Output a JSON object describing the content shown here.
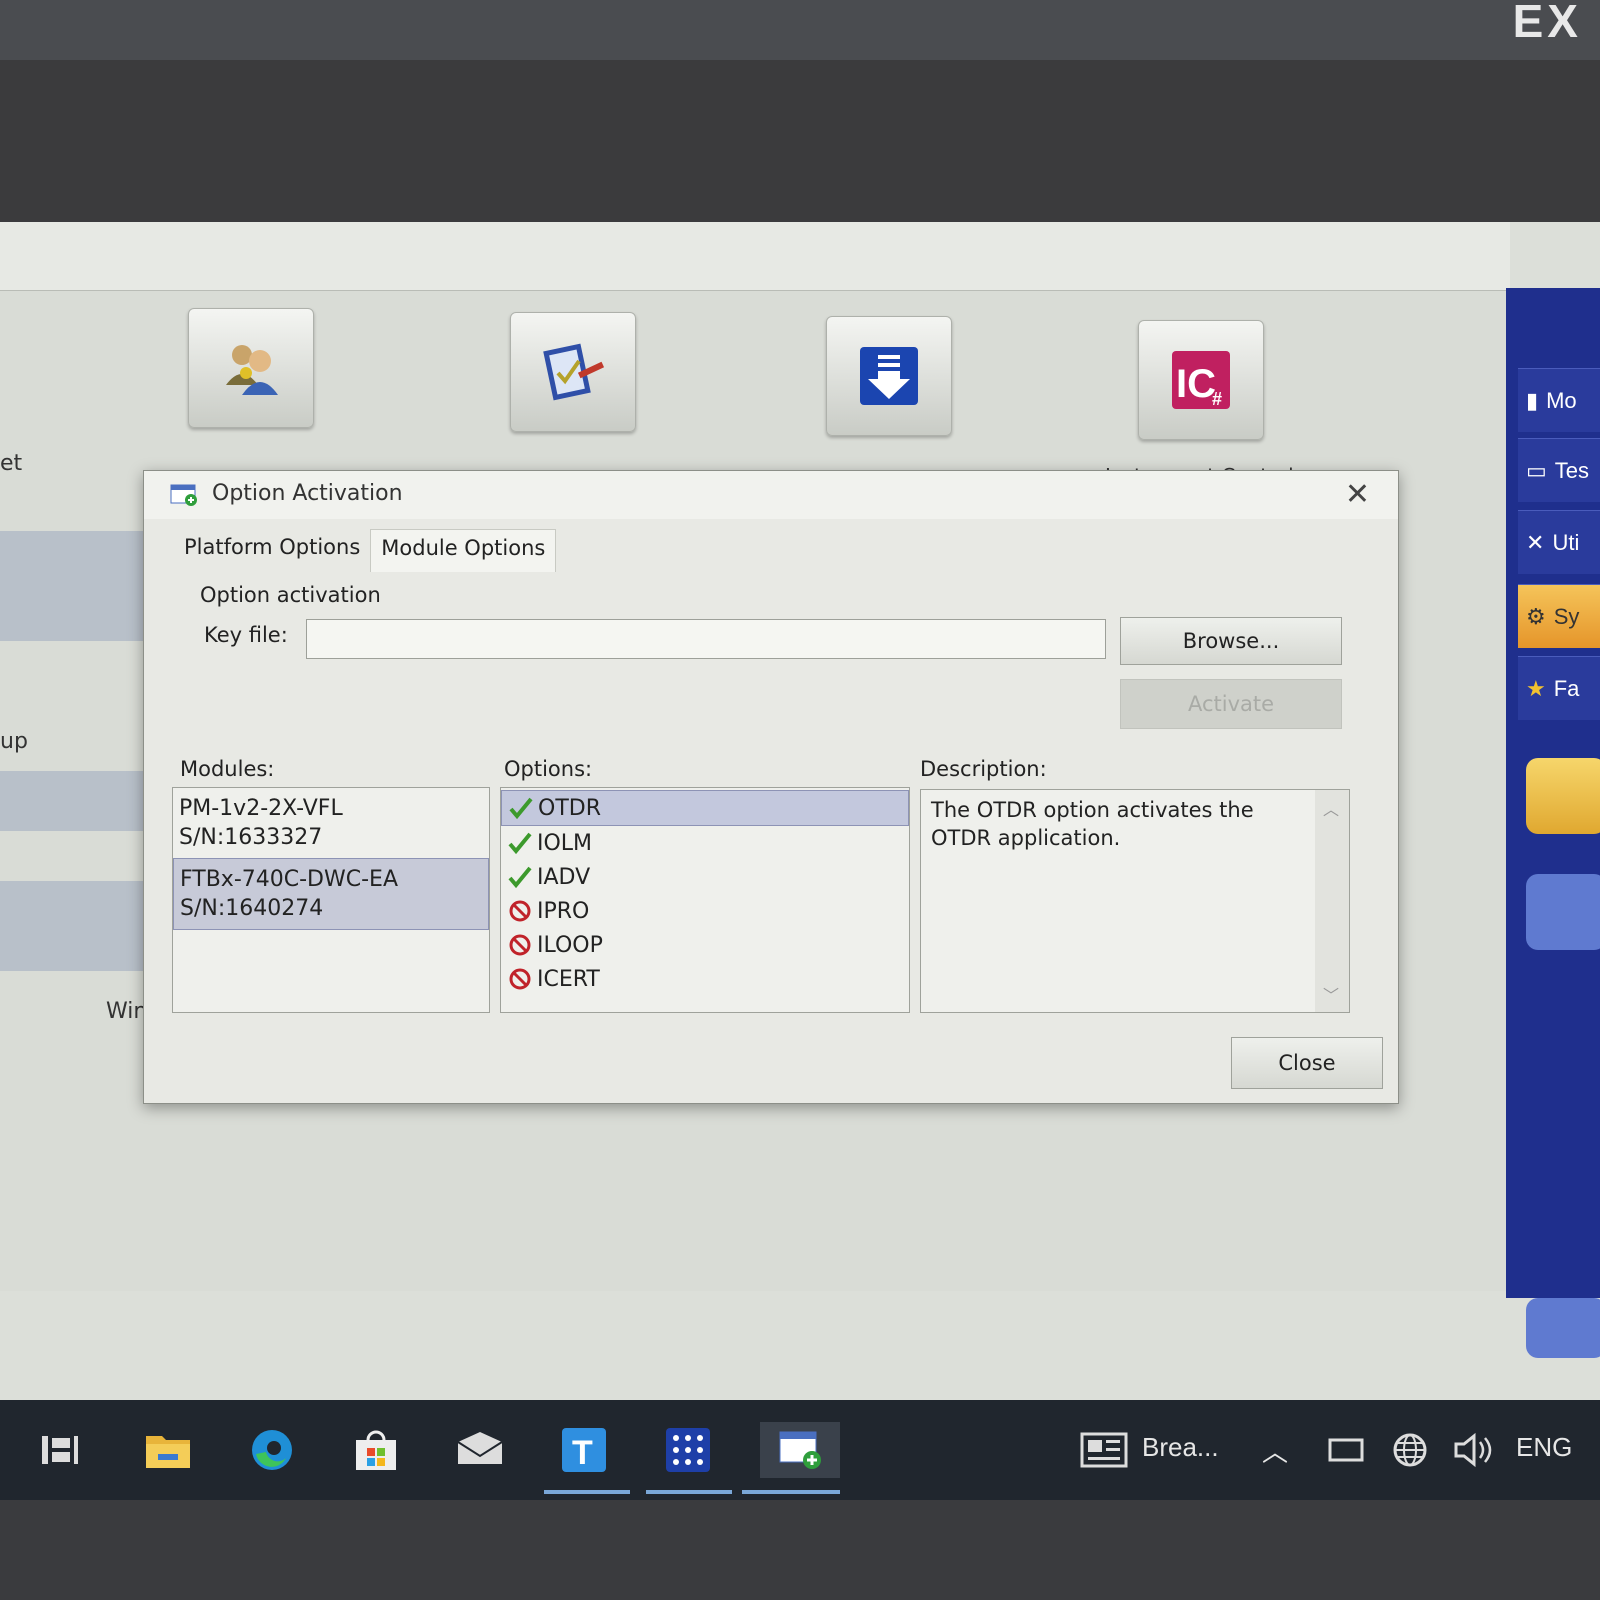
{
  "bezel": {
    "logo": "EX"
  },
  "desktop": {
    "tiles": [
      {
        "name": "users"
      },
      {
        "name": "checklist"
      },
      {
        "name": "download"
      },
      {
        "name": "instrument-control"
      }
    ],
    "instrument_control_label": "Instrument Control",
    "left_fragments": {
      "a": "et",
      "b": "up",
      "c": "Win"
    }
  },
  "sidebar": {
    "items": [
      "Mo",
      "Tes",
      "Uti",
      "Sy",
      "Fa"
    ]
  },
  "dialog": {
    "title": "Option Activation",
    "close_glyph": "✕",
    "tabs": [
      "Platform Options",
      "Module Options"
    ],
    "active_tab": "Module Options",
    "group_label": "Option activation",
    "key_file_label": "Key file:",
    "key_file_value": "",
    "browse_label": "Browse...",
    "activate_label": "Activate",
    "modules_label": "Modules:",
    "options_label": "Options:",
    "description_label": "Description:",
    "modules": [
      {
        "name": "PM-1v2-2X-VFL",
        "sn": "S/N:1633327",
        "selected": false
      },
      {
        "name": "FTBx-740C-DWC-EA",
        "sn": "S/N:1640274",
        "selected": true
      }
    ],
    "options": [
      {
        "label": "OTDR",
        "status": "enabled",
        "selected": true
      },
      {
        "label": "IOLM",
        "status": "enabled",
        "selected": false
      },
      {
        "label": "IADV",
        "status": "enabled",
        "selected": false
      },
      {
        "label": "IPRO",
        "status": "disabled",
        "selected": false
      },
      {
        "label": "ILOOP",
        "status": "disabled",
        "selected": false
      },
      {
        "label": "ICERT",
        "status": "disabled",
        "selected": false
      }
    ],
    "description": "The OTDR option activates the OTDR application.",
    "close_label": "Close"
  },
  "taskbar": {
    "icons": [
      "task-view",
      "file-explorer",
      "edge",
      "store",
      "mail",
      "t-app",
      "dots-app",
      "option-app"
    ],
    "news_label": "Brea...",
    "lang": "ENG",
    "colors": {
      "accent": "#7aa7d8"
    }
  }
}
